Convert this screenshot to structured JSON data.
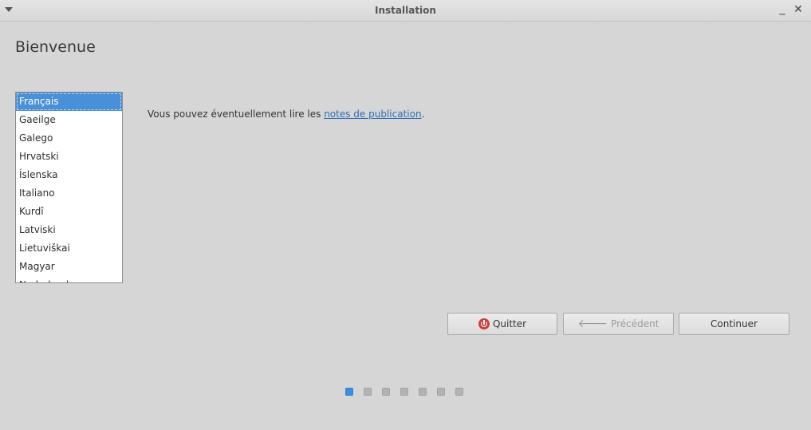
{
  "window": {
    "title": "Installation",
    "minimize_glyph": "_",
    "close_glyph": "✕"
  },
  "page": {
    "title": "Bienvenue"
  },
  "languages": {
    "items": [
      "Français",
      "Gaeilge",
      "Galego",
      "Hrvatski",
      "Íslenska",
      "Italiano",
      "Kurdî",
      "Latviski",
      "Lietuviškai",
      "Magyar",
      "Nederlands"
    ],
    "selected": "Français"
  },
  "release_notes": {
    "prefix": "Vous pouvez éventuellement lire les ",
    "link": "notes de publication",
    "suffix": "."
  },
  "buttons": {
    "quit": "Quitter",
    "back": "Précédent",
    "continue": "Continuer"
  },
  "progress": {
    "steps": 7,
    "current": 1
  },
  "colors": {
    "accent": "#4a90d9",
    "quit_icon": "#d23c3c"
  }
}
